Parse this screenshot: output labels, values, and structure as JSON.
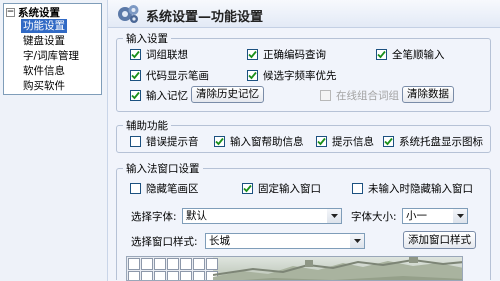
{
  "tree": {
    "root_label": "系统设置",
    "root_toggle": "−",
    "items": [
      {
        "label": "功能设置",
        "selected": true
      },
      {
        "label": "键盘设置",
        "selected": false
      },
      {
        "label": "字/词库管理",
        "selected": false
      },
      {
        "label": "软件信息",
        "selected": false
      },
      {
        "label": "购买软件",
        "selected": false
      }
    ]
  },
  "header": {
    "title": "系统设置—功能设置",
    "icon": "gears-icon"
  },
  "input_settings": {
    "title": "输入设置",
    "options": [
      {
        "label": "词组联想",
        "checked": true,
        "enabled": true
      },
      {
        "label": "正确编码查询",
        "checked": true,
        "enabled": true
      },
      {
        "label": "全笔顺输入",
        "checked": true,
        "enabled": true
      },
      {
        "label": "代码显示笔画",
        "checked": true,
        "enabled": true
      },
      {
        "label": "候选字频率优先",
        "checked": true,
        "enabled": true
      },
      {
        "label": "输入记忆",
        "checked": true,
        "enabled": true
      },
      {
        "label": "在线组合词组",
        "checked": false,
        "enabled": false
      }
    ],
    "clear_history_label": "清除历史记忆",
    "clear_data_label": "清除数据"
  },
  "aux_settings": {
    "title": "辅助功能",
    "options": [
      {
        "label": "错误提示音",
        "checked": false
      },
      {
        "label": "输入窗帮助信息",
        "checked": true
      },
      {
        "label": "提示信息",
        "checked": true
      },
      {
        "label": "系统托盘显示图标",
        "checked": true
      }
    ]
  },
  "window_settings": {
    "title": "输入法窗口设置",
    "options": [
      {
        "label": "隐藏笔画区",
        "checked": false
      },
      {
        "label": "固定输入窗口",
        "checked": true
      },
      {
        "label": "未输入时隐藏输入窗口",
        "checked": false
      }
    ],
    "font_label": "选择字体:",
    "font_value": "默认",
    "font_size_label": "字体大小:",
    "font_size_value": "小一",
    "style_label": "选择窗口样式:",
    "style_value": "长城",
    "add_style_label": "添加窗口样式"
  },
  "colors": {
    "selection": "#316ac5",
    "check": "#1a8f1a"
  }
}
